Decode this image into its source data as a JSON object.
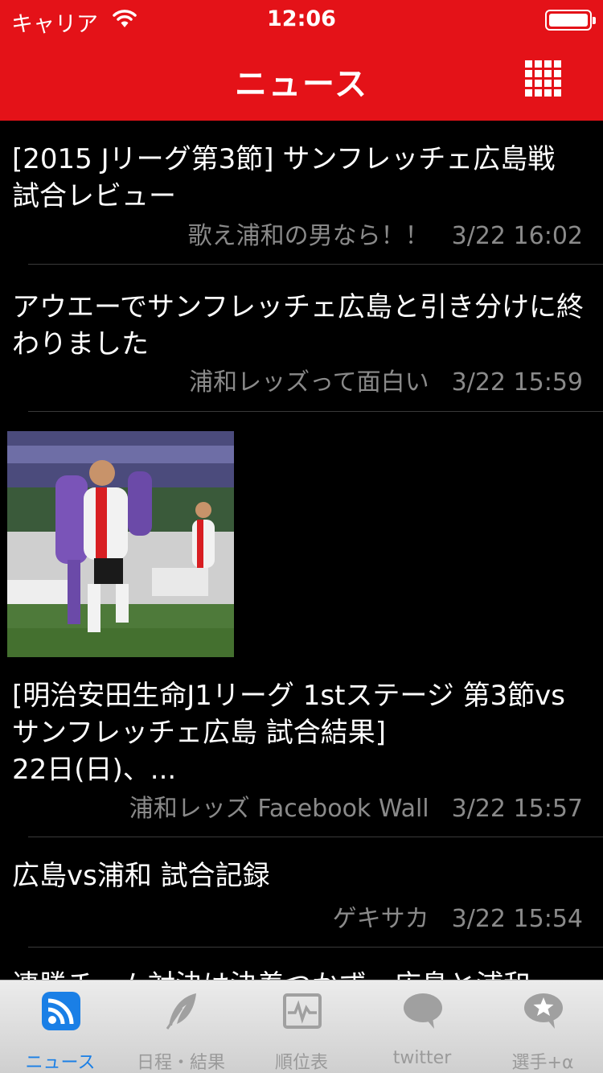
{
  "status": {
    "carrier": "キャリア",
    "time": "12:06"
  },
  "header": {
    "title": "ニュース",
    "grid_icon": "grid-icon"
  },
  "news": [
    {
      "title": "[2015 Jリーグ第3節] サンフレッチェ広島戦 試合レビュー",
      "source": "歌え浦和の男なら！！",
      "time": "3/22 16:02"
    },
    {
      "title": "アウエーでサンフレッチェ広島と引き分けに終わりました",
      "source": "浦和レッズって面白い",
      "time": "3/22 15:59"
    },
    {
      "title": "[明治安田生命J1リーグ 1stステージ 第3節vsサンフレッチェ広島 試合結果]",
      "title_line3": "22日(日)、...",
      "source": "浦和レッズ Facebook Wall",
      "time": "3/22 15:57"
    },
    {
      "title": "広島vs浦和 試合記録",
      "source": "ゲキサカ",
      "time": "3/22 15:54"
    },
    {
      "title": "連勝チーム対決は決着つかず…広島と浦和"
    }
  ],
  "tabs": [
    {
      "label": "ニュース",
      "icon": "rss-icon",
      "active": true
    },
    {
      "label": "日程・結果",
      "icon": "feather-icon",
      "active": false
    },
    {
      "label": "順位表",
      "icon": "chart-icon",
      "active": false
    },
    {
      "label": "twitter",
      "icon": "speech-bubble-icon",
      "active": false
    },
    {
      "label": "選手+α",
      "icon": "star-bubble-icon",
      "active": false
    }
  ],
  "colors": {
    "header_red": "#e41218",
    "tab_active_blue": "#1a7fe6",
    "meta_gray": "#8a8a8a"
  }
}
